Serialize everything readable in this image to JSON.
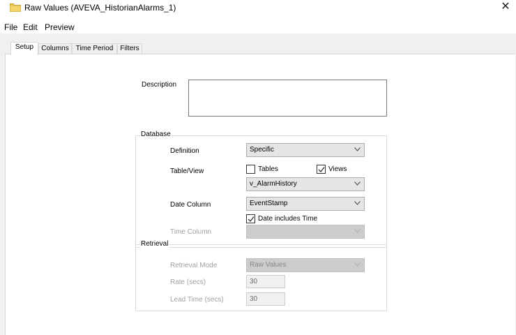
{
  "window": {
    "title": "Raw Values (AVEVA_HistorianAlarms_1)",
    "close_glyph": "✕"
  },
  "menu": [
    "File",
    "Edit",
    "Preview"
  ],
  "tabs": [
    {
      "label": "Setup",
      "active": true
    },
    {
      "label": "Columns",
      "active": false
    },
    {
      "label": "Time Period",
      "active": false
    },
    {
      "label": "Filters",
      "active": false
    }
  ],
  "setup": {
    "description_label": "Description",
    "description_value": "",
    "database": {
      "group_label": "Database",
      "definition_label": "Definition",
      "definition_value": "Specific",
      "table_view_label": "Table/View",
      "tables_label": "Tables",
      "tables_checked": false,
      "views_label": "Views",
      "views_checked": true,
      "table_value": "v_AlarmHistory",
      "date_column_label": "Date Column",
      "date_column_value": "EventStamp",
      "date_includes_time_label": "Date includes Time",
      "date_includes_time_checked": true,
      "time_column_label": "Time Column",
      "time_column_value": ""
    },
    "retrieval": {
      "group_label": "Retrieval",
      "mode_label": "Retrieval Mode",
      "mode_value": "Raw Values",
      "rate_label": "Rate (secs)",
      "rate_value": "30",
      "lead_time_label": "Lead Time (secs)",
      "lead_time_value": "30"
    }
  },
  "colors": {
    "folder": "#e8c34a",
    "panel_bg": "#f0f0f0",
    "disabled_text": "#a0a0a0"
  }
}
